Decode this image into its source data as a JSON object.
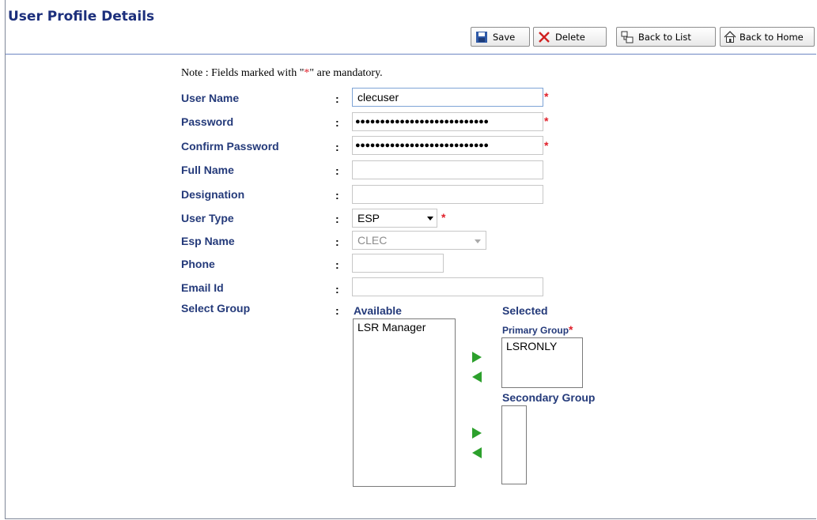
{
  "page": {
    "title": "User Profile Details"
  },
  "toolbar": {
    "save_label": "Save",
    "delete_label": "Delete",
    "back_to_list_label": "Back to List",
    "back_to_home_label": "Back to Home"
  },
  "note": {
    "prefix": "Note : Fields marked with \"",
    "star": "*",
    "suffix": "\" are mandatory."
  },
  "form": {
    "required_mark": "*",
    "colon": ":",
    "user_name": {
      "label": "User Name",
      "value": "clecuser"
    },
    "password": {
      "label": "Password",
      "masked": "●●●●●●●●●●●●●●●●●●●●●●●●●●●"
    },
    "confirm_password": {
      "label": "Confirm Password",
      "masked": "●●●●●●●●●●●●●●●●●●●●●●●●●●●"
    },
    "full_name": {
      "label": "Full Name",
      "value": ""
    },
    "designation": {
      "label": "Designation",
      "value": ""
    },
    "user_type": {
      "label": "User Type",
      "value": "ESP"
    },
    "esp_name": {
      "label": "Esp Name",
      "value": "CLEC"
    },
    "phone": {
      "label": "Phone",
      "value": ""
    },
    "email_id": {
      "label": "Email Id",
      "value": ""
    },
    "select_group": {
      "label": "Select Group"
    }
  },
  "groups": {
    "available_heading": "Available",
    "selected_heading": "Selected",
    "primary_label": "Primary Group",
    "secondary_label": "Secondary Group",
    "available_items": [
      "LSR Manager"
    ],
    "primary_items": [
      "LSRONLY"
    ],
    "secondary_items": []
  },
  "colors": {
    "label_blue": "#243a7a",
    "title_blue": "#1c2f7c",
    "required_red": "#e0202a",
    "arrow_green": "#2ca02c"
  }
}
